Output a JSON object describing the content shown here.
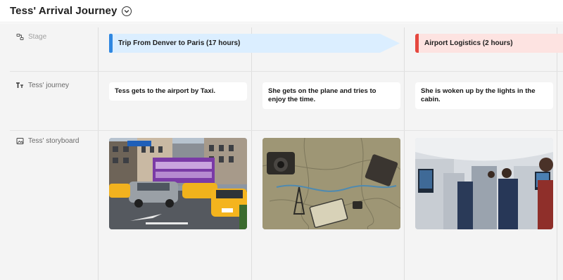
{
  "header": {
    "title": "Tess' Arrival Journey"
  },
  "rows": {
    "stage_label": "Stage",
    "journey_label": "Tess' journey",
    "storyboard_label": "Tess' storyboard"
  },
  "stages": [
    {
      "label": "Trip From Denver to Paris (17 hours)",
      "color": "#dbeeff",
      "accent": "#2f87e0"
    },
    {
      "label": "Airport Logistics (2 hours)",
      "color": "#fde3e1",
      "accent": "#e5483f"
    }
  ],
  "journey": [
    "Tess gets to the airport by Taxi.",
    "She gets on the plane and tries to enjoy the time.",
    "She is woken up by the lights in the cabin."
  ],
  "storyboard": [
    {
      "icon": "taxi-street-photo"
    },
    {
      "icon": "travel-map-photo"
    },
    {
      "icon": "airplane-cabin-photo"
    }
  ]
}
